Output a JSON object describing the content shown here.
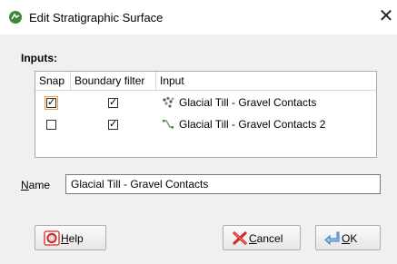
{
  "window": {
    "title": "Edit Stratigraphic Surface",
    "close_glyph": "✕"
  },
  "inputs": {
    "label": "Inputs:",
    "columns": [
      "Snap",
      "Boundary filter",
      "Input"
    ],
    "rows": [
      {
        "snap": true,
        "boundary_filter": true,
        "input": "Glacial Till - Gravel Contacts",
        "icon": "points-icon"
      },
      {
        "snap": false,
        "boundary_filter": true,
        "input": "Glacial Till - Gravel Contacts 2",
        "icon": "polyline-icon"
      }
    ]
  },
  "name": {
    "label_u": "N",
    "label_rest": "ame",
    "value": "Glacial Till - Gravel Contacts"
  },
  "buttons": {
    "help_u": "H",
    "help_rest": "elp",
    "cancel_u": "C",
    "cancel_rest": "ancel",
    "ok_u": "O",
    "ok_rest": "K"
  },
  "check_glyph": "✓",
  "colors": {
    "focus": "#e6a23c",
    "app_icon": "#3a8a3a",
    "help_icon": "#d62828",
    "cancel_icon": "#d62828",
    "ok_icon": "#3a78c2"
  }
}
